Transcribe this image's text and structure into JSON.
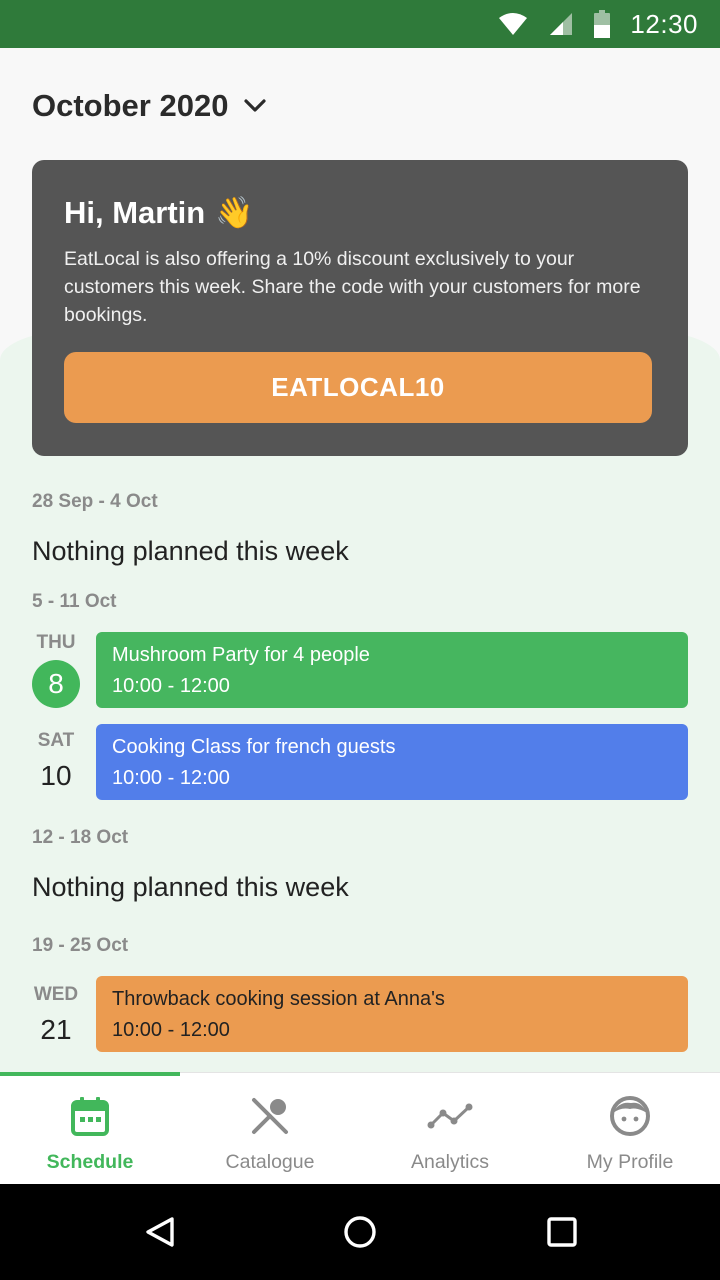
{
  "status_bar": {
    "time": "12:30"
  },
  "header": {
    "month": "October 2020"
  },
  "promo": {
    "greeting": "Hi, Martin",
    "emoji": "👋",
    "message": "EatLocal is also offering a 10% discount exclusively to your customers this week. Share the code with your customers for more bookings.",
    "code": "EATLOCAL10"
  },
  "weeks": [
    {
      "label": "28 Sep - 4 Oct",
      "empty_text": "Nothing planned this week"
    },
    {
      "label": "5 -  11 Oct"
    },
    {
      "label": "12 -  18 Oct",
      "empty_text": "Nothing planned this week"
    },
    {
      "label": "19 -  25 Oct"
    }
  ],
  "events": [
    {
      "dow": "THU",
      "day": "8",
      "title": "Mushroom Party for 4 people",
      "time": "10:00 - 12:00",
      "color": "#46b65f"
    },
    {
      "dow": "SAT",
      "day": "10",
      "title": "Cooking Class for french guests",
      "time": "10:00 - 12:00",
      "color": "#527eea"
    },
    {
      "dow": "WED",
      "day": "21",
      "title": "Throwback cooking session at Anna's",
      "time": "10:00 - 12:00",
      "color": "#eb9b50"
    }
  ],
  "tabs": [
    {
      "label": "Schedule",
      "icon": "calendar-icon",
      "active": true
    },
    {
      "label": "Catalogue",
      "icon": "utensils-icon"
    },
    {
      "label": "Analytics",
      "icon": "line-chart-icon"
    },
    {
      "label": "My Profile",
      "icon": "face-icon"
    }
  ],
  "colors": {
    "status_bar": "#2f7a3a",
    "accent_green": "#42b75b",
    "promo_bg": "#555555",
    "promo_button": "#eb9b50"
  }
}
